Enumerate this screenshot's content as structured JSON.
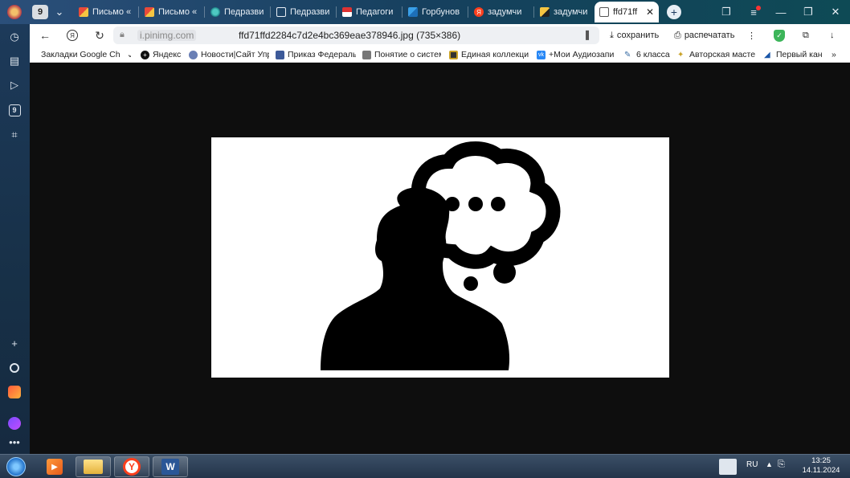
{
  "tabs": [
    {
      "label": "",
      "badge": "9"
    },
    {
      "label": "Письмо «"
    },
    {
      "label": "Письмо «"
    },
    {
      "label": "Педразви"
    },
    {
      "label": "Педразви"
    },
    {
      "label": "Педагоги"
    },
    {
      "label": "Горбунов"
    },
    {
      "label": "задумчи"
    },
    {
      "label": "задумчи"
    },
    {
      "label": "ffd71ff"
    }
  ],
  "sidebar": {
    "badge": "9"
  },
  "address": {
    "host": "i.pinimg.com",
    "title": "ffd71ffd2284c7d2e4bc369eae378946.jpg (735×386)"
  },
  "actions": {
    "save": "сохранить",
    "print": "распечатать"
  },
  "bookmarks": [
    {
      "label": "Закладки Google Ch",
      "color": "#ffffff"
    },
    {
      "label": "Яндекс",
      "color": "#111111"
    },
    {
      "label": "Новости|Сайт Упр",
      "color": "#6a7fb5"
    },
    {
      "label": "Приказ Федераль",
      "color": "#3d5a99"
    },
    {
      "label": "Понятие о систем",
      "color": "#777777"
    },
    {
      "label": "Единая коллекци",
      "color": "#333333"
    },
    {
      "label": "+Мои Аудиозапи",
      "color": "#2787f5"
    },
    {
      "label": "6 класса",
      "color": "#3a6ea5"
    },
    {
      "label": "Авторская масте",
      "color": "#c9a227"
    },
    {
      "label": "Первый кан",
      "color": "#1a56a8"
    }
  ],
  "taskbar": {
    "lang": "RU",
    "time": "13:25",
    "date": "14.11.2024"
  },
  "colors": {
    "accent_active_tab": "#ffffff",
    "viewer_bg": "#0e0e0e"
  }
}
